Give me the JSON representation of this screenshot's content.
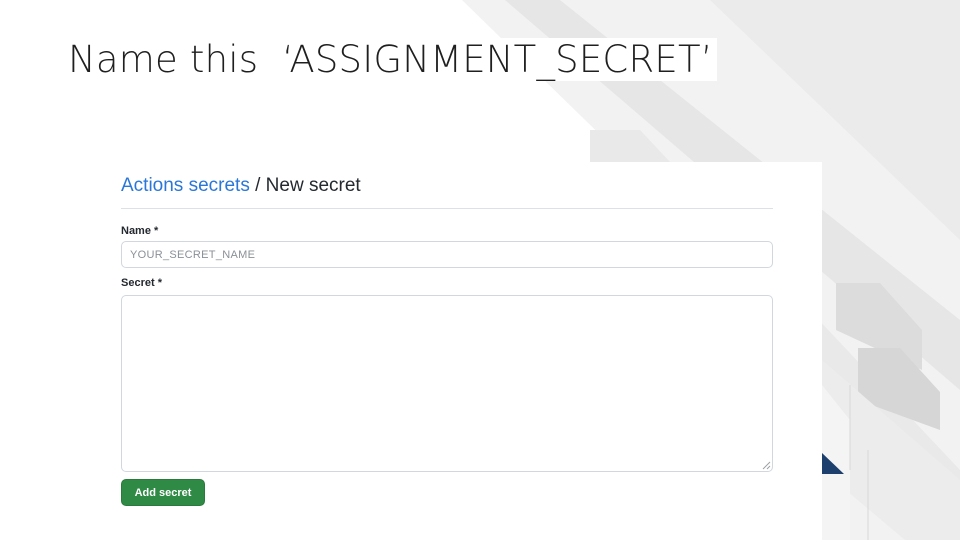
{
  "slide": {
    "title": "Name this  ‘ASSIGNMENT_SECRET’"
  },
  "breadcrumb": {
    "link_label": "Actions secrets",
    "separator": " / ",
    "current": "New secret"
  },
  "form": {
    "name_label": "Name *",
    "name_value": "",
    "name_placeholder": "YOUR_SECRET_NAME",
    "secret_label": "Secret *",
    "secret_value": "",
    "submit_label": "Add secret"
  },
  "colors": {
    "link": "#2a77d8",
    "button": "#2f8a45",
    "accent_navy": "#1d3f6e",
    "decor_light": "#f2f2f2",
    "decor_mid": "#e3e3e3"
  },
  "icons": {
    "resize": "resize-grip-icon"
  }
}
